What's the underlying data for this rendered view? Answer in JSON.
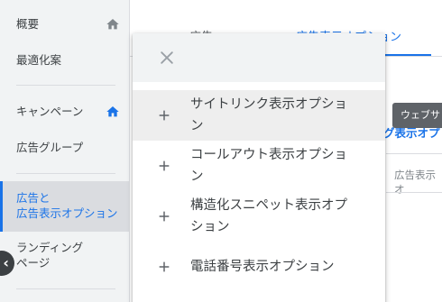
{
  "nav": {
    "items": [
      {
        "label": "概要",
        "icon": "home-icon",
        "icon_color": "#80868b"
      },
      {
        "label": "最適化案"
      },
      {
        "label": "キャンペーン",
        "icon": "home-icon",
        "icon_color": "#1a73e8"
      },
      {
        "label": "広告グループ"
      },
      {
        "label_line1": "広告と",
        "label_line2": "広告表示オプション",
        "active": true
      },
      {
        "label_line1": "ランディング",
        "label_line2": "ページ"
      }
    ],
    "collapse_icon": "‹"
  },
  "tabs": [
    {
      "label": "広告"
    },
    {
      "label": "広告表示オプション",
      "active": true
    }
  ],
  "background": {
    "link_text": "グ表示オプ",
    "column_header": "広告表示オ",
    "tooltip": "ウェブサ"
  },
  "menu": {
    "close_icon": "close-icon",
    "items": [
      {
        "line1": "サイトリンク表示オプショ",
        "line2": "ン",
        "highlighted": true
      },
      {
        "line1": "コールアウト表示オプショ",
        "line2": "ン"
      },
      {
        "line1": "構造化スニペット表示オプ",
        "line2": "ション"
      },
      {
        "line1": "電話番号表示オプション"
      }
    ]
  },
  "colors": {
    "accent": "#1a73e8",
    "nav_background": "#f1f3f4",
    "active_background": "#dadce0"
  }
}
